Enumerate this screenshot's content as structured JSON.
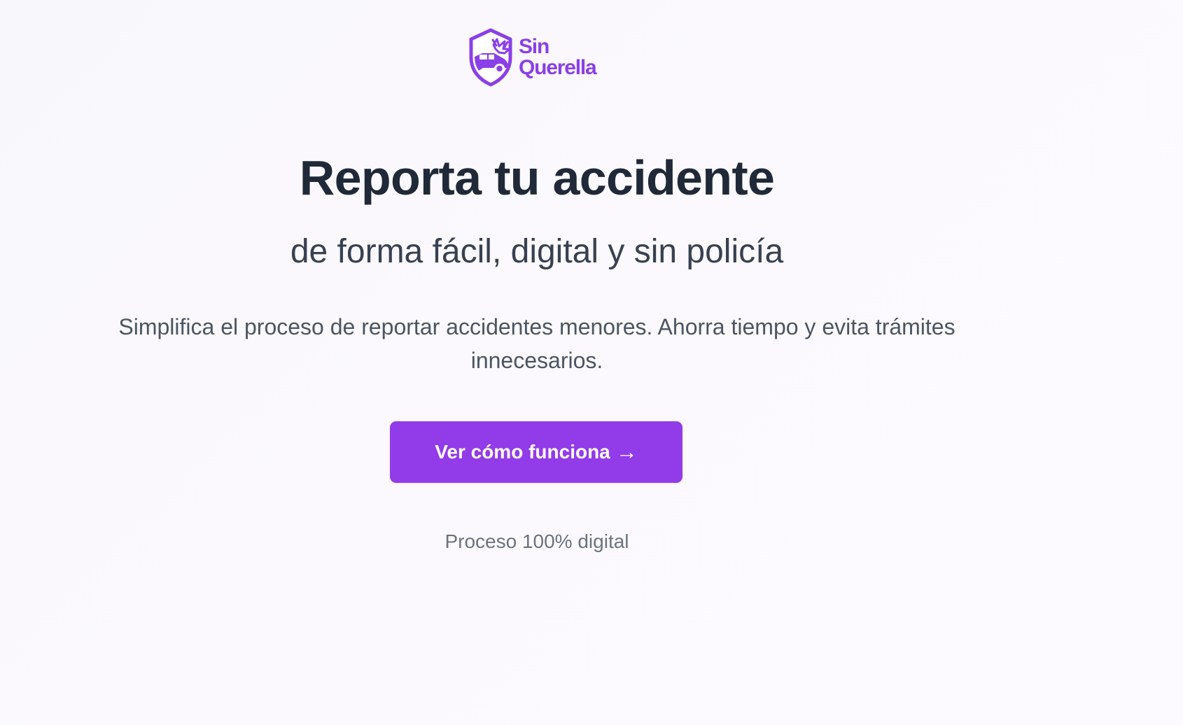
{
  "brand": {
    "name_line_1": "Sin",
    "name_line_2": "Querella",
    "primary_color": "#8a40e6",
    "icon": "shield-car-accident-icon"
  },
  "hero": {
    "title": "Reporta tu accidente",
    "subtitle": "de forma fácil, digital y sin policía",
    "description": "Simplifica el proceso de reportar accidentes menores. Ahorra tiempo y evita trámites innecesarios.",
    "cta": {
      "label": "Ver cómo funciona",
      "arrow": "→",
      "color": "#923be8"
    },
    "note": "Proceso 100% digital"
  },
  "colors": {
    "title": "#1f2937",
    "subtitle": "#374151",
    "body": "#4b5563",
    "muted": "#6b7280"
  }
}
